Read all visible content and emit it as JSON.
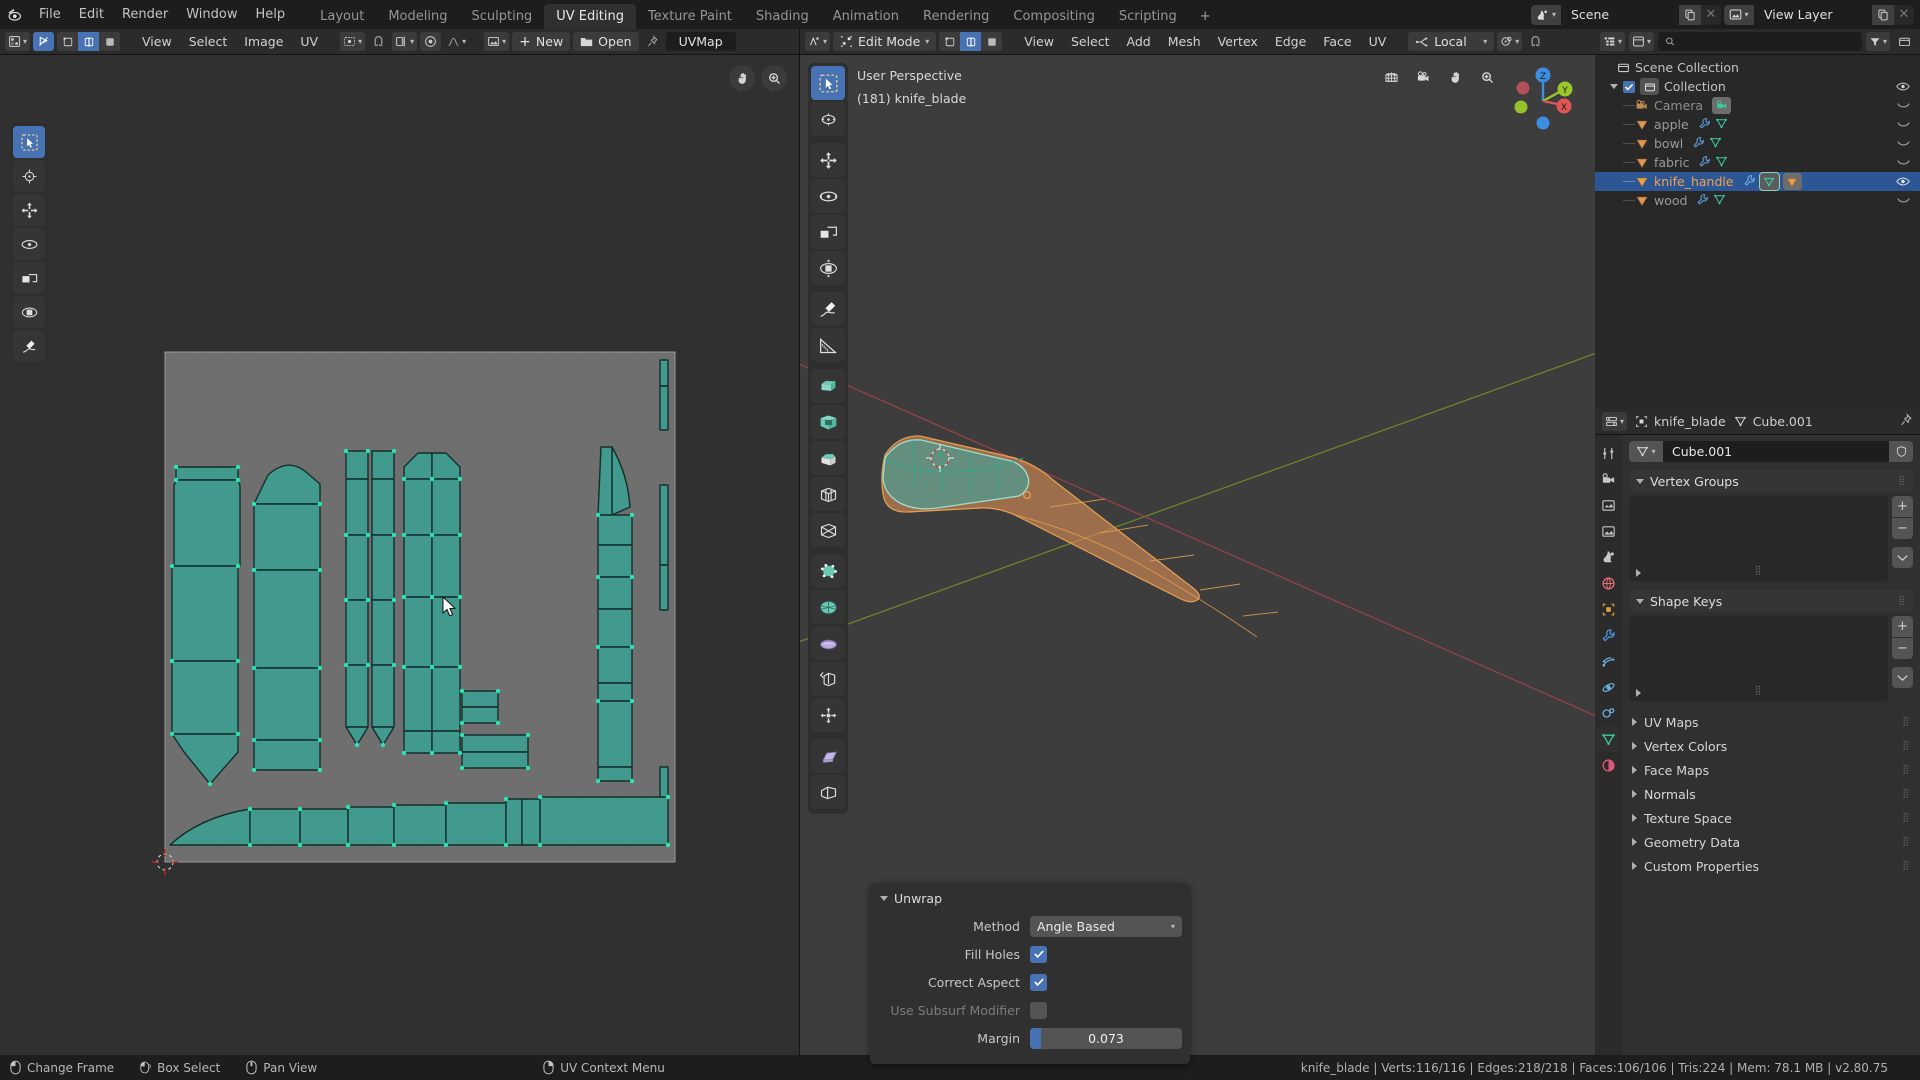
{
  "topbar": {
    "app_icon": "blender-logo",
    "menus": [
      "File",
      "Edit",
      "Render",
      "Window",
      "Help"
    ],
    "workspaces": [
      {
        "label": "Layout",
        "active": false
      },
      {
        "label": "Modeling",
        "active": false
      },
      {
        "label": "Sculpting",
        "active": false
      },
      {
        "label": "UV Editing",
        "active": true
      },
      {
        "label": "Texture Paint",
        "active": false
      },
      {
        "label": "Shading",
        "active": false
      },
      {
        "label": "Animation",
        "active": false
      },
      {
        "label": "Rendering",
        "active": false
      },
      {
        "label": "Compositing",
        "active": false
      },
      {
        "label": "Scripting",
        "active": false
      }
    ],
    "add_workspace": "+",
    "scene_name": "Scene",
    "view_layer_name": "View Layer"
  },
  "uv_editor": {
    "menus": [
      "View",
      "Select",
      "Image",
      "UV"
    ],
    "new_button": "New",
    "open_button": "Open",
    "image_name": "UVMap",
    "pivot_label": "",
    "tools": [
      "tweak-tool-icon",
      "cursor-tool-icon",
      "move-tool-icon",
      "rotate-tool-icon",
      "scale-tool-icon",
      "transform-tool-icon",
      "annotate-tool-icon"
    ],
    "gizmo_buttons": [
      "pan-view-icon",
      "zoom-view-icon"
    ]
  },
  "viewport": {
    "mode": "Edit Mode",
    "menus": [
      "View",
      "Select",
      "Add",
      "Mesh",
      "Vertex",
      "Edge",
      "Face",
      "UV"
    ],
    "orientation": "Local",
    "overlay_line1": "User Perspective",
    "overlay_line2": "(181) knife_blade",
    "gizmo_buttons": [
      "grid-view-icon",
      "camera-view-icon",
      "pan-view-icon",
      "zoom-view-icon"
    ],
    "axis_labels": {
      "x": "X",
      "y": "Y",
      "z": "Z"
    },
    "tools": [
      "select-box-tool-icon",
      "cursor-tool-icon",
      "move-tool-icon",
      "rotate-tool-icon",
      "scale-tool-icon",
      "transform-tool-icon",
      "annotate-tool-icon",
      "measure-tool-icon",
      "extrude-region-tool-icon",
      "inset-faces-tool-icon",
      "bevel-tool-icon",
      "loop-cut-tool-icon",
      "knife-tool-icon",
      "poly-build-tool-icon",
      "spin-tool-icon",
      "smooth-tool-icon",
      "edge-slide-tool-icon",
      "shrink-fatten-tool-icon",
      "shear-tool-icon",
      "rip-region-tool-icon"
    ]
  },
  "operator_panel": {
    "title": "Unwrap",
    "method_label": "Method",
    "method_value": "Angle Based",
    "fill_holes_label": "Fill Holes",
    "fill_holes_checked": true,
    "correct_aspect_label": "Correct Aspect",
    "correct_aspect_checked": true,
    "use_subsurf_label": "Use Subsurf Modifier",
    "use_subsurf_checked": false,
    "margin_label": "Margin",
    "margin_value": "0.073",
    "margin_fill_pct": 7
  },
  "outliner": {
    "search_placeholder": "",
    "rows": [
      {
        "label": "Scene Collection",
        "icon": "collection-icon",
        "depth": 0,
        "selected": false,
        "has_expand": false,
        "checkbox": false,
        "eye": false,
        "badges": []
      },
      {
        "label": "Collection",
        "icon": "collection-icon",
        "depth": 1,
        "selected": false,
        "has_expand": true,
        "checkbox": true,
        "eye": true,
        "badges": []
      },
      {
        "label": "Camera",
        "icon": "camera-object-icon",
        "depth": 2,
        "selected": false,
        "has_expand": true,
        "checkbox": false,
        "eye": false,
        "badges": [
          "camera-data-icon"
        ]
      },
      {
        "label": "apple",
        "icon": "mesh-object-icon",
        "depth": 2,
        "selected": false,
        "has_expand": true,
        "checkbox": false,
        "eye": false,
        "badges": [
          "modifier-icon",
          "mesh-data-icon"
        ]
      },
      {
        "label": "bowl",
        "icon": "mesh-object-icon",
        "depth": 2,
        "selected": false,
        "has_expand": true,
        "checkbox": false,
        "eye": false,
        "badges": [
          "modifier-icon",
          "mesh-data-icon"
        ]
      },
      {
        "label": "fabric",
        "icon": "mesh-object-icon",
        "depth": 2,
        "selected": false,
        "has_expand": true,
        "checkbox": false,
        "eye": false,
        "badges": [
          "modifier-icon",
          "mesh-data-icon"
        ]
      },
      {
        "label": "knife_handle",
        "icon": "mesh-object-icon",
        "depth": 2,
        "selected": true,
        "has_expand": true,
        "checkbox": false,
        "eye": true,
        "badges": [
          "modifier-icon",
          "mesh-data-icon",
          "object-icon"
        ]
      },
      {
        "label": "wood",
        "icon": "mesh-object-icon",
        "depth": 2,
        "selected": false,
        "has_expand": true,
        "checkbox": false,
        "eye": false,
        "badges": [
          "modifier-icon",
          "mesh-data-icon"
        ]
      }
    ]
  },
  "properties": {
    "breadcrumb_object": "knife_blade",
    "breadcrumb_data": "Cube.001",
    "datablock_name": "Cube.001",
    "panels": [
      {
        "label": "Vertex Groups",
        "open": true,
        "has_list": true
      },
      {
        "label": "Shape Keys",
        "open": true,
        "has_list": true
      },
      {
        "label": "UV Maps",
        "open": false,
        "has_list": false
      },
      {
        "label": "Vertex Colors",
        "open": false,
        "has_list": false
      },
      {
        "label": "Face Maps",
        "open": false,
        "has_list": false
      },
      {
        "label": "Normals",
        "open": false,
        "has_list": false
      },
      {
        "label": "Texture Space",
        "open": false,
        "has_list": false
      },
      {
        "label": "Geometry Data",
        "open": false,
        "has_list": false
      },
      {
        "label": "Custom Properties",
        "open": false,
        "has_list": false
      }
    ],
    "tabs": [
      {
        "name": "tool-tab",
        "color": "#c9c9c9",
        "active": false
      },
      {
        "name": "render-tab",
        "color": "#c9c9c9",
        "active": false
      },
      {
        "name": "output-tab",
        "color": "#c9c9c9",
        "active": false
      },
      {
        "name": "view-layer-tab",
        "color": "#c9c9c9",
        "active": false
      },
      {
        "name": "scene-tab",
        "color": "#c9c9c9",
        "active": false
      },
      {
        "name": "world-tab",
        "color": "#e06c75",
        "active": false
      },
      {
        "name": "object-tab",
        "color": "#e8a33d",
        "active": false
      },
      {
        "name": "modifier-tab",
        "color": "#4a90d9",
        "active": false
      },
      {
        "name": "particles-tab",
        "color": "#6fb5e8",
        "active": false
      },
      {
        "name": "physics-tab",
        "color": "#6fb5e8",
        "active": false
      },
      {
        "name": "constraints-tab",
        "color": "#6fb5e8",
        "active": false
      },
      {
        "name": "object-data-tab",
        "color": "#3bc9a0",
        "active": true
      },
      {
        "name": "material-tab",
        "color": "#e0557a",
        "active": false
      }
    ],
    "list_add": "+",
    "list_remove": "−"
  },
  "statusbar": {
    "hints": [
      {
        "label": "Change Frame",
        "icon": "mouse-left-icon"
      },
      {
        "label": "Box Select",
        "icon": "mouse-left-drag-icon"
      },
      {
        "label": "Pan View",
        "icon": "mouse-middle-icon"
      },
      {
        "label": "UV Context Menu",
        "icon": "mouse-right-icon"
      }
    ],
    "stats": "knife_blade | Verts:116/116 | Edges:218/218 | Faces:106/106 | Tris:224 | Mem: 78.1 MB | v2.80.75"
  },
  "colors": {
    "accent_blue": "#4772b3",
    "uv_island_fill": "#3f9b8e",
    "uv_island_edge": "#1d4b44",
    "uv_vertex": "#28e0b0",
    "selected_orange": "#f0a24b",
    "mesh_green": "#3bc9a0",
    "axis_x": "#e25555",
    "axis_y": "#9ac828",
    "axis_z": "#3d8ee0"
  }
}
